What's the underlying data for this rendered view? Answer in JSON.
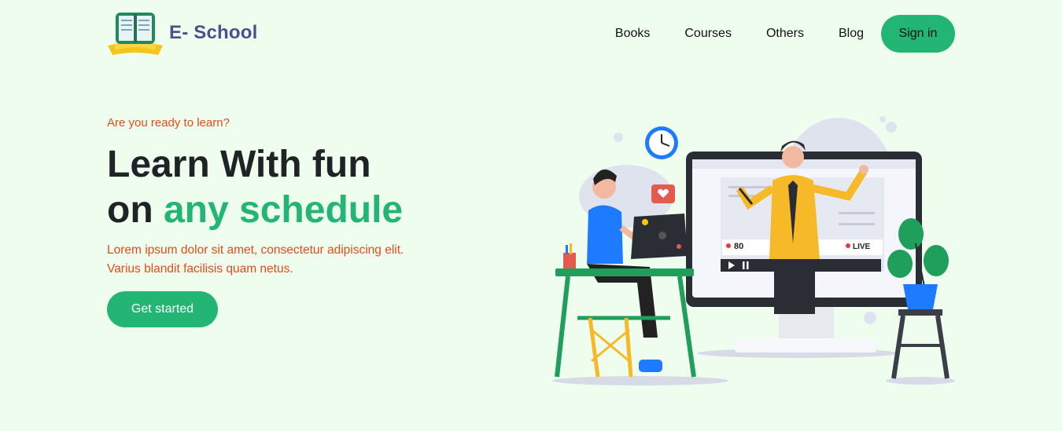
{
  "brand": {
    "name": "E- School",
    "logo_icon": "book-icon"
  },
  "nav": {
    "items": [
      {
        "label": "Books"
      },
      {
        "label": "Courses"
      },
      {
        "label": "Others"
      },
      {
        "label": "Blog"
      }
    ],
    "signin_label": "Sign in"
  },
  "hero": {
    "kicker": "Are you ready to learn?",
    "headline_line1": "Learn With fun",
    "headline_line2_prefix": "on ",
    "headline_line2_accent": "any schedule",
    "description": "Lorem ipsum dolor sit amet, consectetur adipiscing elit. Varius blandit facilisis quam netus.",
    "cta_label": "Get started"
  },
  "illustration": {
    "viewer_count": "80",
    "live_label": "LIVE"
  },
  "colors": {
    "background": "#effdef",
    "accent_green": "#22b573",
    "accent_orange": "#e44c19",
    "brand_text": "#4b4f8c"
  }
}
